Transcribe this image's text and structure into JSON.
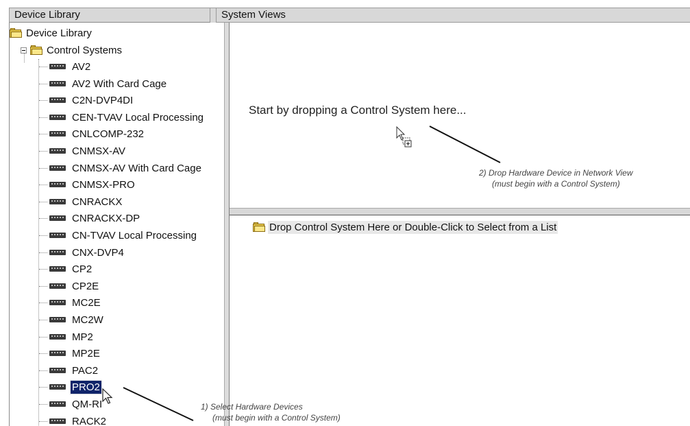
{
  "left_panel": {
    "header": "Device Library",
    "root_label": "Device Library",
    "category_label": "Control Systems",
    "items": [
      "AV2",
      "AV2 With Card Cage",
      "C2N-DVP4DI",
      "CEN-TVAV Local Processing",
      "CNLCOMP-232",
      "CNMSX-AV",
      "CNMSX-AV With Card Cage",
      "CNMSX-PRO",
      "CNRACKX",
      "CNRACKX-DP",
      "CN-TVAV Local Processing",
      "CNX-DVP4",
      "CP2",
      "CP2E",
      "MC2E",
      "MC2W",
      "MP2",
      "MP2E",
      "PAC2",
      "PRO2",
      "QM-RI",
      "RACK2"
    ],
    "selected_item": "PRO2"
  },
  "right_panel": {
    "header": "System Views",
    "network_view_prompt": "Start by dropping a Control System here...",
    "hardware_prompt": "Drop Control System Here or Double-Click to Select from a List"
  },
  "annotations": {
    "step2_line1": "2) Drop Hardware Device in Network View",
    "step2_line2": "(must begin with a Control System)",
    "step1_line1": "1) Select Hardware Devices",
    "step1_line2": "(must begin with a Control System)"
  },
  "colors": {
    "selection": "#10246a",
    "folder": "#e7c94c",
    "header_bg": "#d8d8d8"
  },
  "icons": {
    "folder": "folder-icon",
    "device": "device-icon",
    "cursor": "mouse-pointer-icon",
    "drag_copy_cursor": "drag-copy-cursor-icon"
  }
}
